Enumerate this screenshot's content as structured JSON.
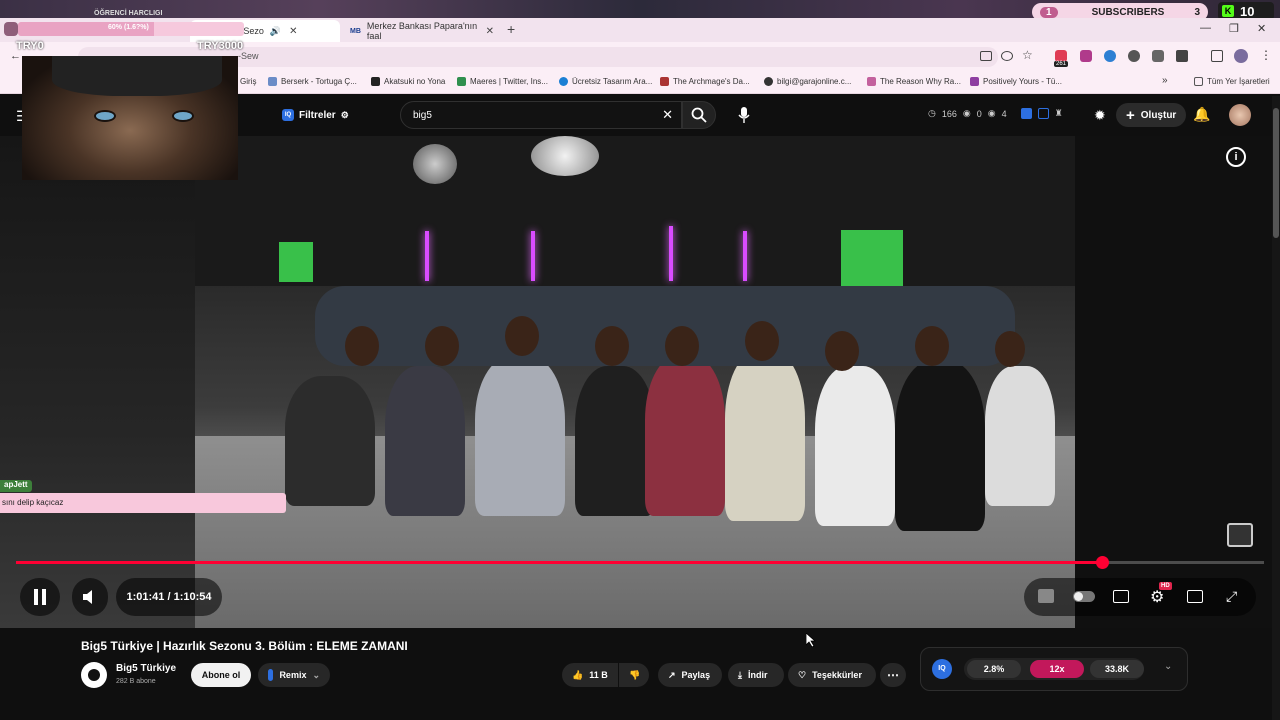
{
  "overlay": {
    "donation_title": "ÖĞRENCİ HARCLIGI",
    "donation_progress_text": "60% (1.6?%)",
    "donation_progress_fraction": 0.6,
    "currency_left": "TRY0",
    "currency_right": "TRY3000",
    "subs_count_left": "1",
    "subs_label": "SUBSCRIBERS",
    "subs_count_right": "3",
    "kick_count": "10",
    "chat_user": "apJett",
    "chat_message": "sını delip kaçıcaz"
  },
  "browser": {
    "tabs": [
      {
        "label": "e | Hazırlık Sezo",
        "active": true
      },
      {
        "label": "Merkez Bankası Papara'nın faal",
        "active": false
      }
    ],
    "new_tab": "+",
    "address_partial": "-Sew",
    "bookmarks": [
      {
        "label": "Giriş"
      },
      {
        "label": "Berserk - Tortuga Ç..."
      },
      {
        "label": "Akatsuki no Yona"
      },
      {
        "label": "Maeres | Twitter, Ins..."
      },
      {
        "label": "Ücretsiz Tasarım Ara..."
      },
      {
        "label": "The Archmage's Da..."
      },
      {
        "label": "bilgi@garajonline.c..."
      },
      {
        "label": "The Reason Why Ra..."
      },
      {
        "label": "Positively Yours - Tü..."
      }
    ],
    "bookmarks_more": "»",
    "all_bookmarks": "Tüm Yer İşaretleri",
    "extension_badge": "261"
  },
  "youtube": {
    "filters_label": "Filtreler",
    "search_value": "big5",
    "stats": {
      "views": "166",
      "a": "0",
      "b": "4"
    },
    "create_label": "Oluştur"
  },
  "player": {
    "current_time": "1:01:41",
    "separator": " / ",
    "duration": "1:10:54",
    "progress_fraction": 0.8699,
    "hd_badge": "HD"
  },
  "video": {
    "title": "Big5 Türkiye | Hazırlık Sezonu 3. Bölüm : ELEME ZAMANI",
    "channel_name": "Big5 Türkiye",
    "subscribers": "282 B abone",
    "subscribe_label": "Abone ol",
    "remix_label": "Remix",
    "like_count": "11 B",
    "share_label": "Paylaş",
    "download_label": "İndir",
    "thanks_label": "Teşekkürler"
  },
  "extension_panel": {
    "value1": "2.8%",
    "value2": "12x",
    "value3": "33.8K"
  },
  "colors": {
    "accent_red": "#ff0033",
    "pink": "#c2185b",
    "overlay_pink": "#f8c8dc"
  }
}
